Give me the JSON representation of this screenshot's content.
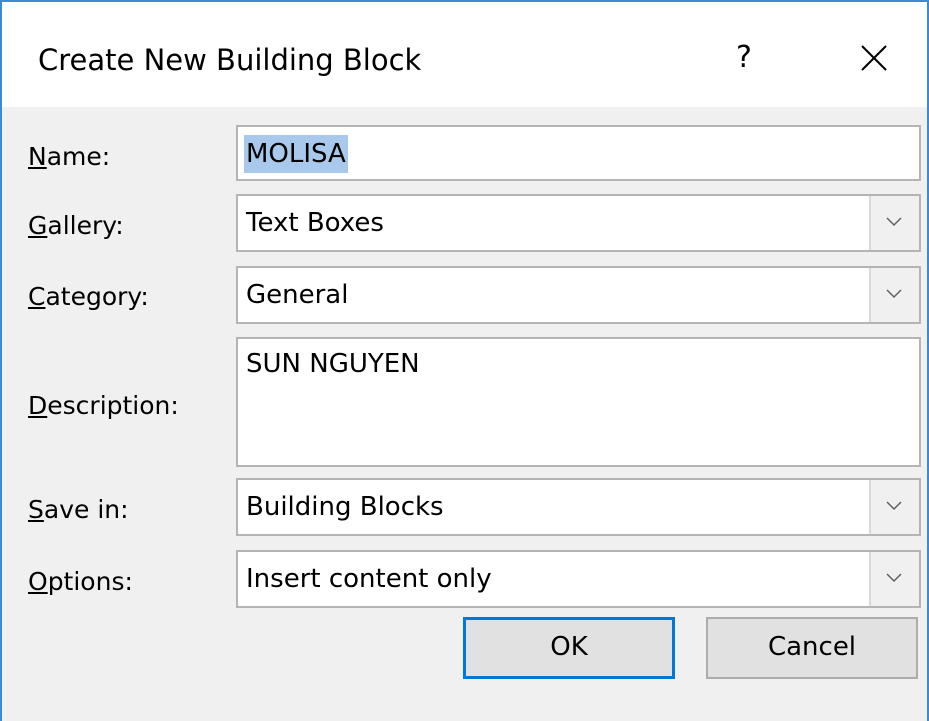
{
  "dialog": {
    "title": "Create New Building Block",
    "help_label": "?"
  },
  "form": {
    "name": {
      "label_key": "N",
      "label_rest": "ame:",
      "value": "MOLISA",
      "selected": true
    },
    "gallery": {
      "label_key": "G",
      "label_rest": "allery:",
      "value": "Text Boxes"
    },
    "category": {
      "label_key": "C",
      "label_rest": "ategory:",
      "value": "General"
    },
    "description": {
      "label_key": "D",
      "label_rest": "escription:",
      "value": "SUN NGUYEN"
    },
    "save_in": {
      "label_key": "S",
      "label_rest": "ave in:",
      "value": "Building Blocks"
    },
    "options": {
      "label_key": "O",
      "label_rest": "ptions:",
      "value": "Insert content only"
    }
  },
  "buttons": {
    "ok": "OK",
    "cancel": "Cancel"
  },
  "colors": {
    "window_border": "#3c8ad4",
    "selection": "#a9c9ec",
    "default_button_border": "#0078d7"
  }
}
